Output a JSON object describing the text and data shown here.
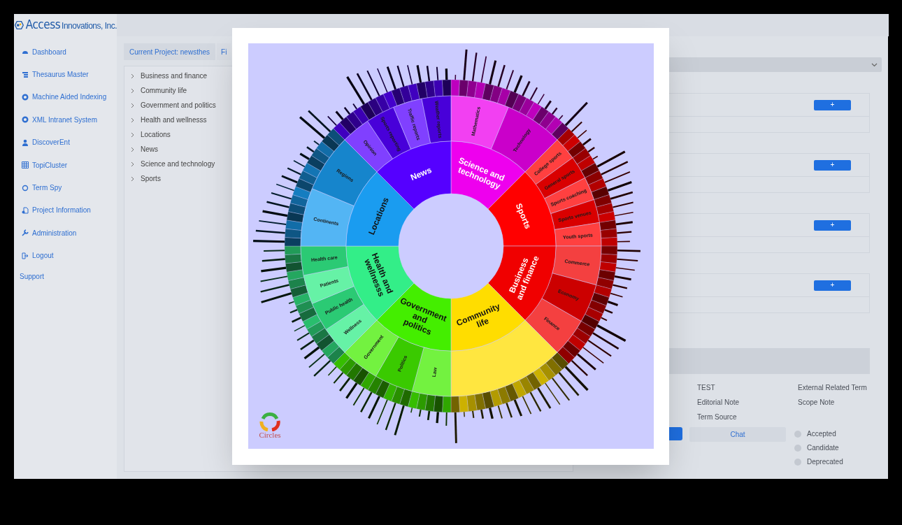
{
  "brand": {
    "name": "Access",
    "suffix": "Innovations, Inc."
  },
  "sidebar": {
    "items": [
      {
        "label": "Dashboard",
        "selected": false
      },
      {
        "label": "Thesaurus Master",
        "selected": false
      },
      {
        "label": "Machine Aided Indexing",
        "selected": false
      },
      {
        "label": "XML Intranet System",
        "selected": false
      },
      {
        "label": "DiscoverEnt",
        "selected": false
      },
      {
        "label": "TopiCluster",
        "selected": false
      },
      {
        "label": "Term Spy",
        "selected": false
      },
      {
        "label": "Project Information",
        "selected": false
      },
      {
        "label": "Administration",
        "selected": false
      },
      {
        "label": "Logout",
        "selected": false
      }
    ],
    "support": "Support"
  },
  "tabs": [
    {
      "label": "Current Project: newsthes",
      "selected": true
    },
    {
      "label": "Fi",
      "selected": false
    }
  ],
  "tree": [
    {
      "label": "Business and finance",
      "expanded": false
    },
    {
      "label": "Community life",
      "expanded": false
    },
    {
      "label": "Government and politics",
      "expanded": false
    },
    {
      "label": "Health and wellnesss",
      "expanded": false
    },
    {
      "label": "Locations",
      "expanded": false
    },
    {
      "label": "News",
      "expanded": false
    },
    {
      "label": "Science and technology",
      "expanded": false
    },
    {
      "label": "Sports",
      "expanded": false
    }
  ],
  "add_buttons": [
    "+",
    "+",
    "+",
    "+"
  ],
  "fields": [
    [
      "TEST",
      "External Related Term"
    ],
    [
      "Editorial Note",
      "Scope Note"
    ],
    [
      "Term Source"
    ]
  ],
  "chat_button": "Chat",
  "status_options": [
    {
      "label": "Accepted",
      "selected": false
    },
    {
      "label": "Candidate",
      "selected": false
    },
    {
      "label": "Deprecated",
      "selected": false
    }
  ],
  "sunburst": {
    "segments": [
      {
        "label": "Science and technology",
        "color": "#ee00ee",
        "children": [
          "Mathematics",
          "Technology"
        ]
      },
      {
        "label": "Sports",
        "color": "#ff0000",
        "children": [
          "College sports",
          "General sports",
          "Sports coaching",
          "Sports venues",
          "Youth sports"
        ]
      },
      {
        "label": "Business and finance",
        "color": "#f00000",
        "children": [
          "Commerce",
          "Economy",
          "Finance"
        ]
      },
      {
        "label": "Community life",
        "color": "#ffdd00"
      },
      {
        "label": "Government and politics",
        "color": "#44ee00",
        "children": [
          "Law",
          "Politics",
          "Government"
        ]
      },
      {
        "label": "Health and wellnesss",
        "color": "#33ee88",
        "children": [
          "Wellness",
          "Public health",
          "Patients",
          "Health care"
        ]
      },
      {
        "label": "Locations",
        "color": "#1a9cf0",
        "children": [
          "Continents",
          "Regions"
        ]
      },
      {
        "label": "News",
        "color": "#5500ff",
        "children": [
          "Opinion",
          "Sports reporting",
          "Traffic reports",
          "Weather reports"
        ]
      }
    ],
    "logo_text": "Circles"
  }
}
